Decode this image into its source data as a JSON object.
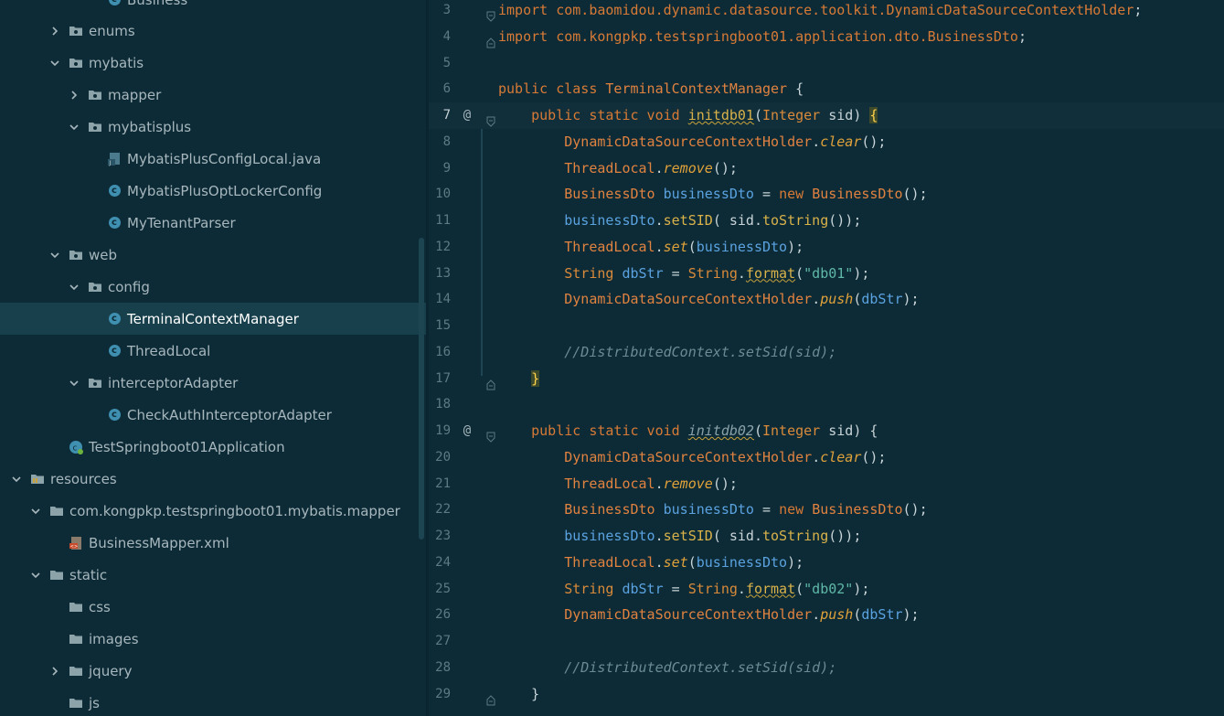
{
  "tree": {
    "items": [
      {
        "label": "Business",
        "depth": 3,
        "kind": "class",
        "chevron": "none"
      },
      {
        "label": "enums",
        "depth": 1,
        "kind": "package",
        "chevron": "collapsed"
      },
      {
        "label": "mybatis",
        "depth": 1,
        "kind": "package",
        "chevron": "expanded"
      },
      {
        "label": "mapper",
        "depth": 2,
        "kind": "package",
        "chevron": "collapsed"
      },
      {
        "label": "mybatisplus",
        "depth": 2,
        "kind": "package",
        "chevron": "expanded"
      },
      {
        "label": "MybatisPlusConfigLocal.java",
        "depth": 3,
        "kind": "javafile",
        "chevron": "none"
      },
      {
        "label": "MybatisPlusOptLockerConfig",
        "depth": 3,
        "kind": "class",
        "chevron": "none"
      },
      {
        "label": "MyTenantParser",
        "depth": 3,
        "kind": "class",
        "chevron": "none"
      },
      {
        "label": "web",
        "depth": 1,
        "kind": "package",
        "chevron": "expanded"
      },
      {
        "label": "config",
        "depth": 2,
        "kind": "package",
        "chevron": "expanded"
      },
      {
        "label": "TerminalContextManager",
        "depth": 3,
        "kind": "class",
        "chevron": "none",
        "selected": true
      },
      {
        "label": "ThreadLocal",
        "depth": 3,
        "kind": "class",
        "chevron": "none"
      },
      {
        "label": "interceptorAdapter",
        "depth": 2,
        "kind": "package",
        "chevron": "expanded"
      },
      {
        "label": "CheckAuthInterceptorAdapter",
        "depth": 3,
        "kind": "class",
        "chevron": "none"
      },
      {
        "label": "TestSpringboot01Application",
        "depth": 1,
        "kind": "springapp",
        "chevron": "none"
      },
      {
        "label": "resources",
        "depth": -1,
        "kind": "resources",
        "chevron": "expanded"
      },
      {
        "label": "com.kongpkp.testspringboot01.mybatis.mapper",
        "depth": 0,
        "kind": "folder",
        "chevron": "expanded"
      },
      {
        "label": "BusinessMapper.xml",
        "depth": 1,
        "kind": "xmlfile",
        "chevron": "none"
      },
      {
        "label": "static",
        "depth": 0,
        "kind": "folder",
        "chevron": "expanded"
      },
      {
        "label": "css",
        "depth": 1,
        "kind": "folder",
        "chevron": "none"
      },
      {
        "label": "images",
        "depth": 1,
        "kind": "folder",
        "chevron": "none"
      },
      {
        "label": "jquery",
        "depth": 1,
        "kind": "folder",
        "chevron": "collapsed"
      },
      {
        "label": "js",
        "depth": 1,
        "kind": "folder",
        "chevron": "none"
      }
    ]
  },
  "editor": {
    "lines": [
      {
        "num": "3",
        "mark": "",
        "fold": "top",
        "tokens": [
          [
            "kw",
            "import "
          ],
          [
            "pkg",
            "com.baomidou.dynamic.datasource.toolkit.DynamicDataSourceContextHolder"
          ],
          [
            "plain",
            ";"
          ]
        ]
      },
      {
        "num": "4",
        "mark": "",
        "fold": "bottom",
        "tokens": [
          [
            "kw",
            "import "
          ],
          [
            "pkg",
            "com.kongpkp.testspringboot01.application.dto.BusinessDto"
          ],
          [
            "plain",
            ";"
          ]
        ]
      },
      {
        "num": "5",
        "mark": "",
        "fold": "",
        "tokens": []
      },
      {
        "num": "6",
        "mark": "",
        "fold": "",
        "tokens": [
          [
            "kw",
            "public class "
          ],
          [
            "cls",
            "TerminalContextManager"
          ],
          [
            "plain",
            " {"
          ]
        ]
      },
      {
        "num": "7",
        "mark": "@",
        "fold": "top",
        "current": true,
        "tokens": [
          [
            "plain",
            "    "
          ],
          [
            "kw",
            "public static void "
          ],
          [
            "fn",
            "initdb01"
          ],
          [
            "plain",
            "("
          ],
          [
            "ty",
            "Integer"
          ],
          [
            "plain",
            " sid) "
          ],
          [
            "brace",
            "{"
          ]
        ]
      },
      {
        "num": "8",
        "mark": "",
        "fold": "",
        "tokens": [
          [
            "plain",
            "        "
          ],
          [
            "cls",
            "DynamicDataSourceContextHolder"
          ],
          [
            "plain",
            "."
          ],
          [
            "mthi",
            "clear"
          ],
          [
            "plain",
            "();"
          ]
        ]
      },
      {
        "num": "9",
        "mark": "",
        "fold": "",
        "tokens": [
          [
            "plain",
            "        "
          ],
          [
            "cls",
            "ThreadLocal"
          ],
          [
            "plain",
            "."
          ],
          [
            "mthi",
            "remove"
          ],
          [
            "plain",
            "();"
          ]
        ]
      },
      {
        "num": "10",
        "mark": "",
        "fold": "",
        "tokens": [
          [
            "plain",
            "        "
          ],
          [
            "cls",
            "BusinessDto "
          ],
          [
            "var",
            "businessDto"
          ],
          [
            "plain",
            " = "
          ],
          [
            "kw",
            "new "
          ],
          [
            "cls",
            "BusinessDto"
          ],
          [
            "plain",
            "();"
          ]
        ]
      },
      {
        "num": "11",
        "mark": "",
        "fold": "",
        "tokens": [
          [
            "plain",
            "        "
          ],
          [
            "var",
            "businessDto"
          ],
          [
            "plain",
            "."
          ],
          [
            "mth",
            "setSID"
          ],
          [
            "plain",
            "( sid."
          ],
          [
            "mth",
            "toString"
          ],
          [
            "plain",
            "());"
          ]
        ]
      },
      {
        "num": "12",
        "mark": "",
        "fold": "",
        "tokens": [
          [
            "plain",
            "        "
          ],
          [
            "cls",
            "ThreadLocal"
          ],
          [
            "plain",
            "."
          ],
          [
            "mthi",
            "set"
          ],
          [
            "plain",
            "("
          ],
          [
            "var",
            "businessDto"
          ],
          [
            "plain",
            ");"
          ]
        ]
      },
      {
        "num": "13",
        "mark": "",
        "fold": "",
        "tokens": [
          [
            "plain",
            "        "
          ],
          [
            "ty",
            "String "
          ],
          [
            "var",
            "dbStr"
          ],
          [
            "plain",
            " = "
          ],
          [
            "ty",
            "String"
          ],
          [
            "plain",
            "."
          ],
          [
            "fn",
            "format"
          ],
          [
            "plain",
            "("
          ],
          [
            "str",
            "\"db01\""
          ],
          [
            "plain",
            ");"
          ]
        ]
      },
      {
        "num": "14",
        "mark": "",
        "fold": "",
        "tokens": [
          [
            "plain",
            "        "
          ],
          [
            "cls",
            "DynamicDataSourceContextHolder"
          ],
          [
            "plain",
            "."
          ],
          [
            "mthi",
            "push"
          ],
          [
            "plain",
            "("
          ],
          [
            "var",
            "dbStr"
          ],
          [
            "plain",
            ");"
          ]
        ]
      },
      {
        "num": "15",
        "mark": "",
        "fold": "",
        "tokens": []
      },
      {
        "num": "16",
        "mark": "",
        "fold": "",
        "tokens": [
          [
            "plain",
            "        "
          ],
          [
            "cmt",
            "//DistributedContext.setSid(sid);"
          ]
        ]
      },
      {
        "num": "17",
        "mark": "",
        "fold": "bottom",
        "tokens": [
          [
            "plain",
            "    "
          ],
          [
            "brace",
            "}"
          ]
        ]
      },
      {
        "num": "18",
        "mark": "",
        "fold": "",
        "tokens": []
      },
      {
        "num": "19",
        "mark": "@",
        "fold": "top",
        "tokens": [
          [
            "plain",
            "    "
          ],
          [
            "kw",
            "public static void "
          ],
          [
            "fn-unused",
            "initdb02"
          ],
          [
            "plain",
            "("
          ],
          [
            "ty",
            "Integer"
          ],
          [
            "plain",
            " sid) {"
          ]
        ]
      },
      {
        "num": "20",
        "mark": "",
        "fold": "",
        "tokens": [
          [
            "plain",
            "        "
          ],
          [
            "cls",
            "DynamicDataSourceContextHolder"
          ],
          [
            "plain",
            "."
          ],
          [
            "mthi",
            "clear"
          ],
          [
            "plain",
            "();"
          ]
        ]
      },
      {
        "num": "21",
        "mark": "",
        "fold": "",
        "tokens": [
          [
            "plain",
            "        "
          ],
          [
            "cls",
            "ThreadLocal"
          ],
          [
            "plain",
            "."
          ],
          [
            "mthi",
            "remove"
          ],
          [
            "plain",
            "();"
          ]
        ]
      },
      {
        "num": "22",
        "mark": "",
        "fold": "",
        "tokens": [
          [
            "plain",
            "        "
          ],
          [
            "cls",
            "BusinessDto "
          ],
          [
            "var",
            "businessDto"
          ],
          [
            "plain",
            " = "
          ],
          [
            "kw",
            "new "
          ],
          [
            "cls",
            "BusinessDto"
          ],
          [
            "plain",
            "();"
          ]
        ]
      },
      {
        "num": "23",
        "mark": "",
        "fold": "",
        "tokens": [
          [
            "plain",
            "        "
          ],
          [
            "var",
            "businessDto"
          ],
          [
            "plain",
            "."
          ],
          [
            "mth",
            "setSID"
          ],
          [
            "plain",
            "( sid."
          ],
          [
            "mth",
            "toString"
          ],
          [
            "plain",
            "());"
          ]
        ]
      },
      {
        "num": "24",
        "mark": "",
        "fold": "",
        "tokens": [
          [
            "plain",
            "        "
          ],
          [
            "cls",
            "ThreadLocal"
          ],
          [
            "plain",
            "."
          ],
          [
            "mthi",
            "set"
          ],
          [
            "plain",
            "("
          ],
          [
            "var",
            "businessDto"
          ],
          [
            "plain",
            ");"
          ]
        ]
      },
      {
        "num": "25",
        "mark": "",
        "fold": "",
        "tokens": [
          [
            "plain",
            "        "
          ],
          [
            "ty",
            "String "
          ],
          [
            "var",
            "dbStr"
          ],
          [
            "plain",
            " = "
          ],
          [
            "ty",
            "String"
          ],
          [
            "plain",
            "."
          ],
          [
            "fn",
            "format"
          ],
          [
            "plain",
            "("
          ],
          [
            "str",
            "\"db02\""
          ],
          [
            "plain",
            ");"
          ]
        ]
      },
      {
        "num": "26",
        "mark": "",
        "fold": "",
        "tokens": [
          [
            "plain",
            "        "
          ],
          [
            "cls",
            "DynamicDataSourceContextHolder"
          ],
          [
            "plain",
            "."
          ],
          [
            "mthi",
            "push"
          ],
          [
            "plain",
            "("
          ],
          [
            "var",
            "dbStr"
          ],
          [
            "plain",
            ");"
          ]
        ]
      },
      {
        "num": "27",
        "mark": "",
        "fold": "",
        "tokens": []
      },
      {
        "num": "28",
        "mark": "",
        "fold": "",
        "tokens": [
          [
            "plain",
            "        "
          ],
          [
            "cmt",
            "//DistributedContext.setSid(sid);"
          ]
        ]
      },
      {
        "num": "29",
        "mark": "",
        "fold": "bottom",
        "tokens": [
          [
            "plain",
            "    }"
          ]
        ]
      }
    ]
  },
  "colors": {
    "background": "#0d2b36",
    "selected_row": "#18404c",
    "keyword": "#d77a36",
    "variable": "#5aa2e0",
    "string": "#5fb8a8",
    "comment": "#6a8b94"
  }
}
